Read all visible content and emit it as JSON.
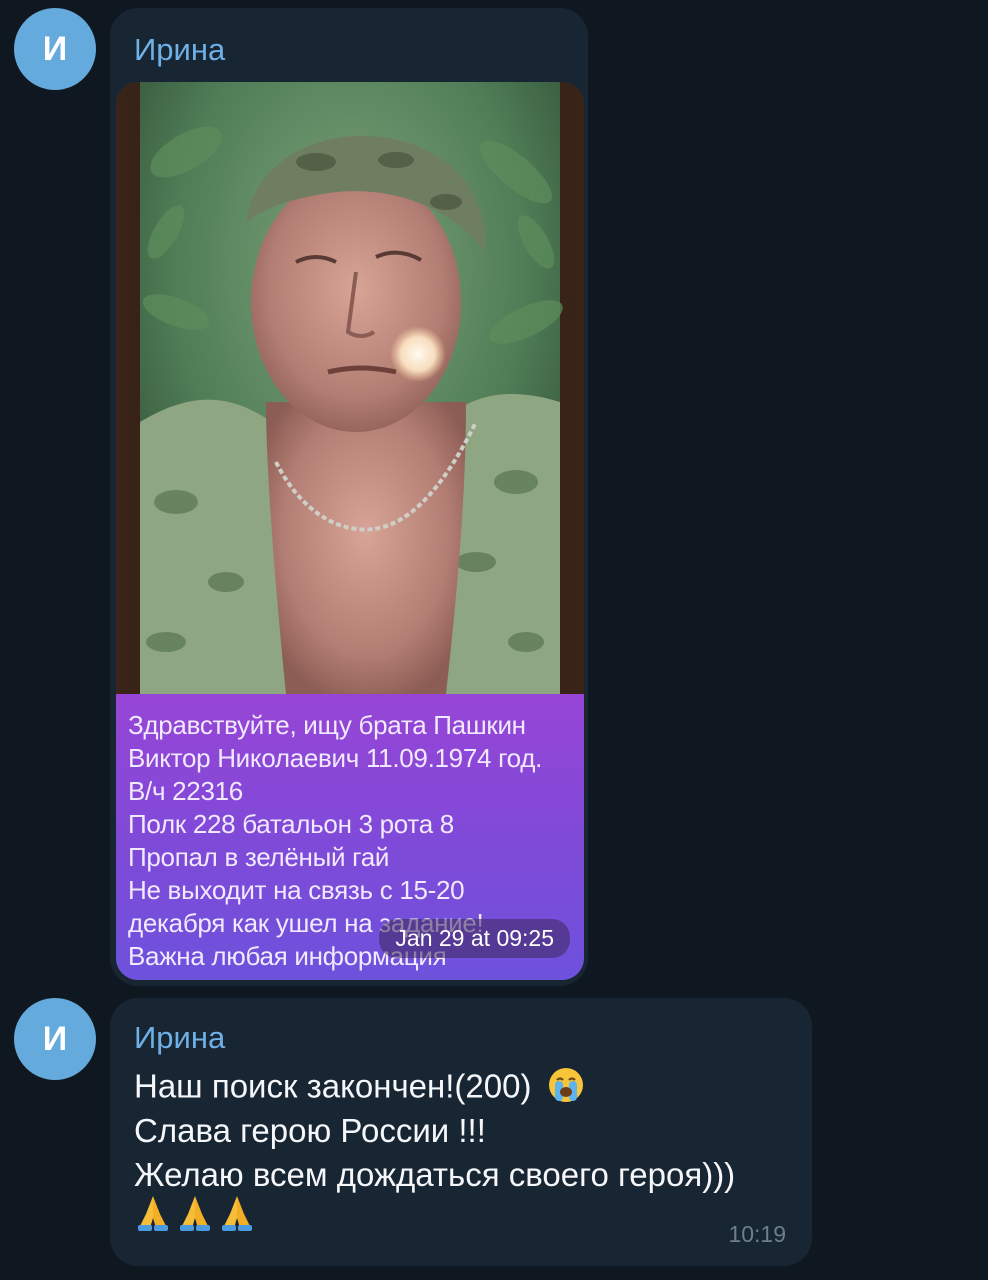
{
  "messages": [
    {
      "avatar_letter": "И",
      "sender": "Ирина",
      "caption_lines": [
        "Здравствуйте, ищу брата Пашкин",
        "Виктор Николаевич 11.09.1974 год.",
        "В/ч 22316",
        "Полк 228 батальон 3 рота 8",
        "Пропал в зелёный гай",
        "Не выходит на связь с 15-20",
        "декабря как ушел на задание!",
        "Важна любая информация"
      ],
      "media_time": "Jan 29 at 09:25"
    },
    {
      "avatar_letter": "И",
      "sender": "Ирина",
      "lines": [
        "Наш поиск закончен!(200)",
        "Слава герою России !!!",
        "Желаю всем дождаться своего героя)))"
      ],
      "emoji_cry": "loudly-crying-face-icon",
      "emoji_hands": [
        "folded-hands-icon",
        "folded-hands-icon",
        "folded-hands-icon"
      ],
      "time": "10:19"
    }
  ],
  "colors": {
    "background": "#0f1721",
    "bubble": "#182533",
    "avatar": "#65aadd",
    "sender": "#6fb0e6",
    "caption_bg": "#8a48d8"
  }
}
